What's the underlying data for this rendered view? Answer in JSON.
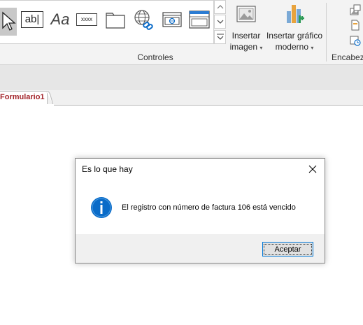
{
  "ribbon": {
    "controls_group_label": "Controles",
    "header_group_label": "Encabeza",
    "gallery_controls": [
      {
        "name": "select-pointer-icon"
      },
      {
        "name": "textbox-icon",
        "text": "ab|"
      },
      {
        "name": "label-icon",
        "text": "Aa"
      },
      {
        "name": "button-icon",
        "text": "xxxx"
      },
      {
        "name": "tab-control-icon"
      },
      {
        "name": "hyperlink-icon"
      },
      {
        "name": "web-browser-icon"
      },
      {
        "name": "navigation-control-icon"
      }
    ],
    "insert_image": {
      "line1": "Insertar",
      "line2": "imagen",
      "caret": "▾"
    },
    "insert_chart": {
      "line1": "Insertar gráfico",
      "line2": "moderno",
      "caret": "▾"
    }
  },
  "document": {
    "tab_label": "Formulario1"
  },
  "dialog": {
    "title": "Es lo que hay",
    "message": "El registro con número de factura 106 está vencido",
    "ok_label": "Aceptar",
    "close_glyph": "✕"
  },
  "colors": {
    "accent": "#0078d7",
    "tab_text": "#a4262c",
    "info_icon": "#0a6bc8"
  }
}
